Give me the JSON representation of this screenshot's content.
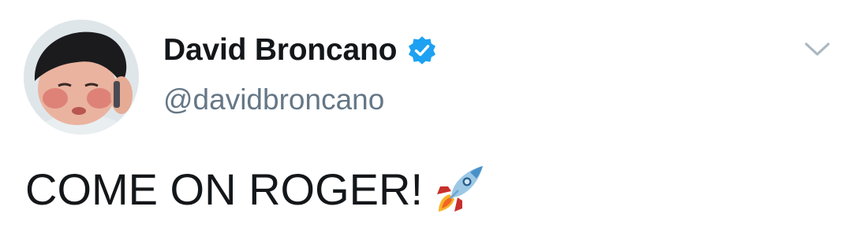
{
  "user": {
    "display_name": "David Broncano",
    "handle": "@davidbroncano",
    "verified": true,
    "avatar_icon": "avatar-photo"
  },
  "tweet": {
    "text": "COME ON ROGER!",
    "emoji": "rocket-emoji"
  },
  "icons": {
    "verified": "verified-badge-icon",
    "menu": "chevron-down-icon"
  },
  "colors": {
    "name": "#14171a",
    "handle": "#657786",
    "verified_badge": "#1da1f2",
    "caret": "#aab8c2"
  }
}
